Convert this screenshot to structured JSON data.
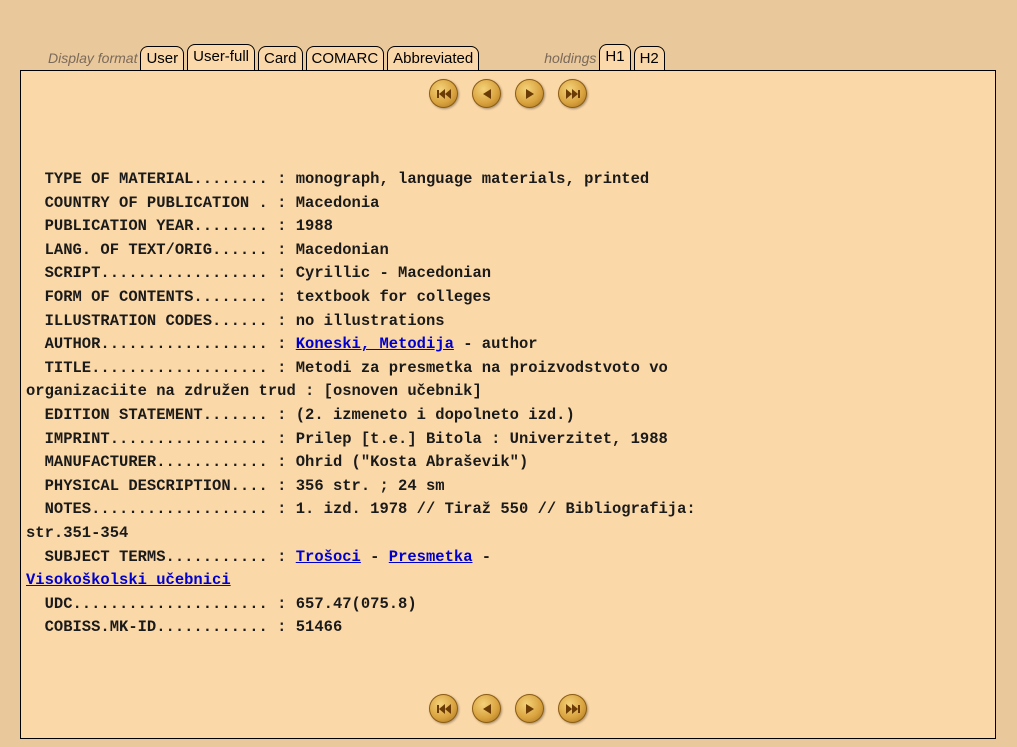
{
  "tabs": {
    "display_format_label": "Display format",
    "formats": [
      "User",
      "User-full",
      "Card",
      "COMARC",
      "Abbreviated"
    ],
    "active_format": "User-full",
    "holdings_label": "holdings",
    "holdings": [
      "H1",
      "H2"
    ],
    "active_holding": "H1"
  },
  "nav": {
    "first": "first-record",
    "prev": "previous-record",
    "next": "next-record",
    "last": "last-record"
  },
  "record": {
    "type_line": "  TYPE OF MATERIAL........ : monograph, language materials, printed",
    "country_line": "  COUNTRY OF PUBLICATION . : Macedonia",
    "year_line": "  PUBLICATION YEAR........ : 1988",
    "lang_line": "  LANG. OF TEXT/ORIG...... : Macedonian",
    "script_line": "  SCRIPT.................. : Cyrillic - Macedonian",
    "form_line": "  FORM OF CONTENTS........ : textbook for colleges",
    "illus_line": "  ILLUSTRATION CODES...... : no illustrations",
    "author_prefix": "  AUTHOR.................. : ",
    "author_link": "Koneski, Metodija",
    "author_suffix": " - author",
    "title_line1": "  TITLE................... : Metodi za presmetka na proizvodstvoto vo",
    "title_line2": "organizaciite na združen trud : [osnoven učebnik]",
    "edition_line": "  EDITION STATEMENT....... : (2. izmeneto i dopolneto izd.)",
    "imprint_line": "  IMPRINT................. : Prilep [t.e.] Bitola : Univerzitet, 1988",
    "manufacturer_line": "  MANUFACTURER............ : Ohrid (\"Kosta Abraševik\")",
    "physical_line": "  PHYSICAL DESCRIPTION.... : 356 str. ; 24 sm",
    "notes_line1": "  NOTES................... : 1. izd. 1978 // Tiraž 550 // Bibliografija:",
    "notes_line2": "str.351-354",
    "subject_prefix": "  SUBJECT TERMS........... : ",
    "subject_link1": "Trošoci",
    "subject_sep1": " - ",
    "subject_link2": "Presmetka",
    "subject_sep2": " -",
    "subject_link3": "Visokoškolski učebnici",
    "udc_line": "  UDC..................... : 657.47(075.8)",
    "cobiss_line": "  COBISS.MK-ID............ : 51466"
  },
  "colors": {
    "background": "#e9c89c",
    "panel": "#fbd8a8",
    "link": "#0000cc",
    "nav_button": "#d9a23e"
  }
}
